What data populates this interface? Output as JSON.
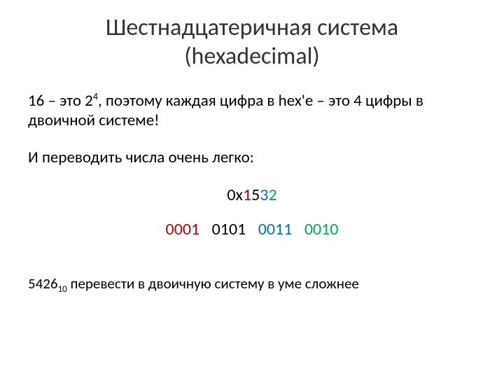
{
  "title_line1": "Шестнадцатеричная система",
  "title_line2": "(hexadecimal)",
  "intro_prefix": "16 – это 2",
  "intro_exp": "4",
  "intro_suffix": ", поэтому каждая цифра в hex'е – это 4 цифры в двоичной системе!",
  "convert_lead": "И переводить числа очень легко:",
  "hex": {
    "prefix": "0x",
    "d1": "1",
    "d2": "5",
    "d3": "3",
    "d4": "2"
  },
  "bin": {
    "g1": "0001",
    "g2": "0101",
    "g3": "0011",
    "g4": "0010"
  },
  "footer_num": "5426",
  "footer_sub": "10",
  "footer_suffix": " перевести в двоичную систему в уме сложнее"
}
